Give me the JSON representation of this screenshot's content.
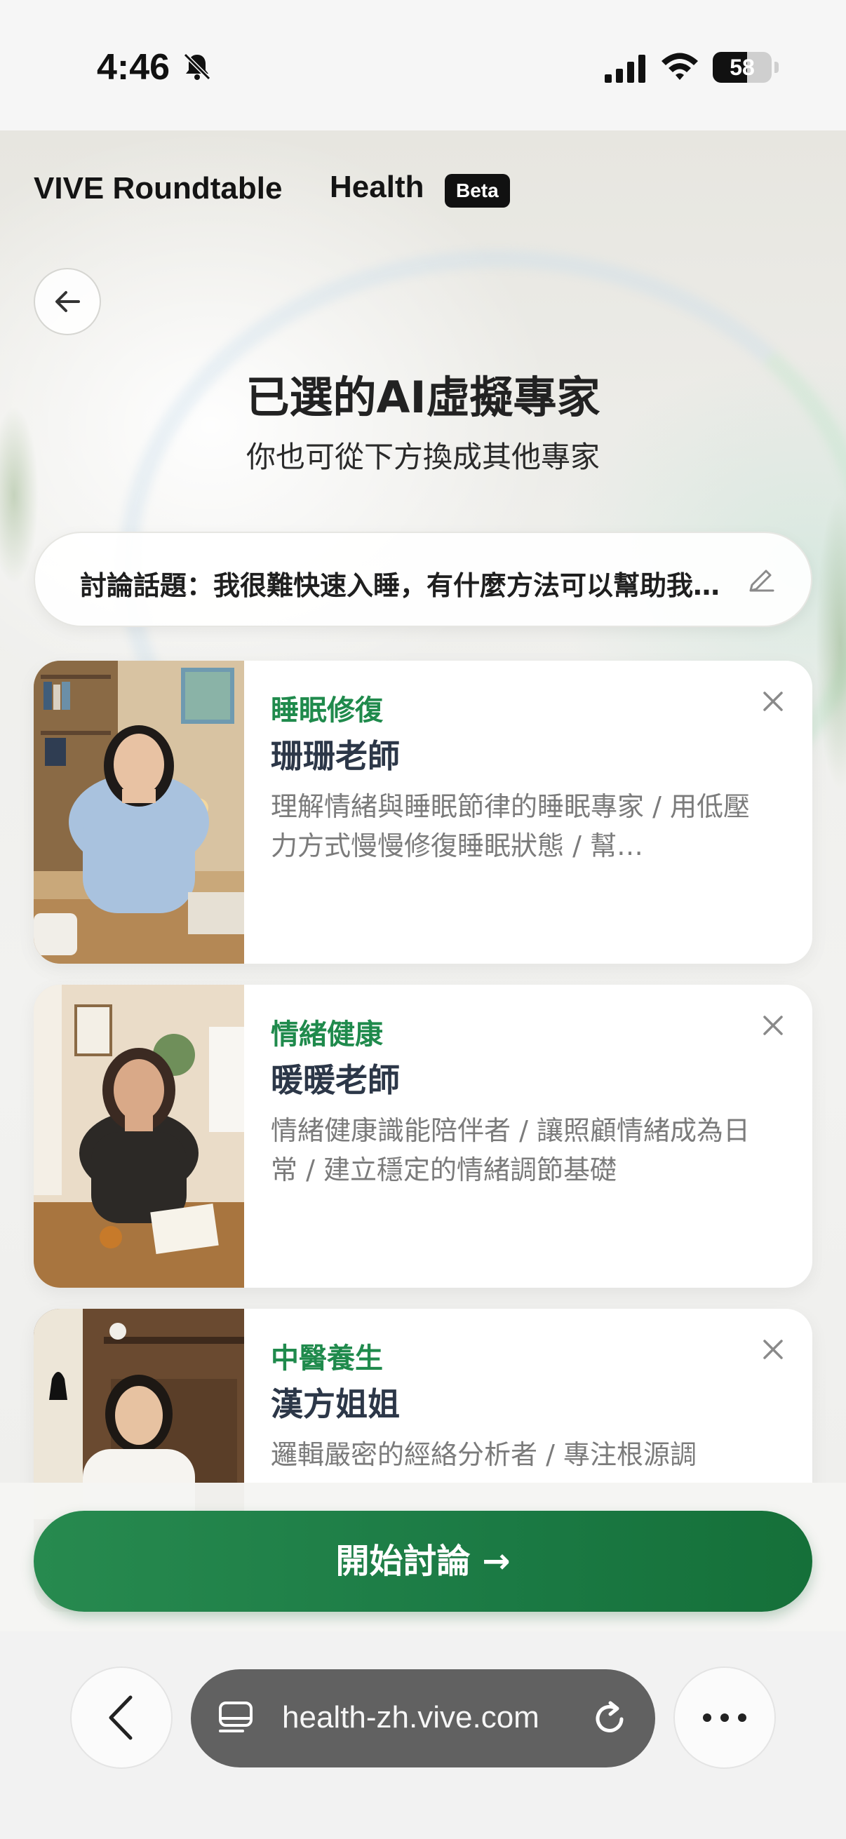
{
  "status_bar": {
    "time": "4:46",
    "battery": "58",
    "battery_level_pct": 58
  },
  "header": {
    "brand": "VIVE Roundtable",
    "product": "Health",
    "badge": "Beta"
  },
  "page": {
    "title": "已選的AI虛擬專家",
    "subtitle": "你也可從下方換成其他專家",
    "topic": "討論話題：我很難快速入睡，有什麼方法可以幫助我更快入睡？"
  },
  "experts": [
    {
      "category": "睡眠修復",
      "name": "珊珊老師",
      "description": "理解情緒與睡眠節律的睡眠專家 / 用低壓力方式慢慢修復睡眠狀態 / 幫…"
    },
    {
      "category": "情緒健康",
      "name": "暖暖老師",
      "description": "情緒健康識能陪伴者 / 讓照顧情緒成為日常 / 建立穩定的情緒調節基礎"
    },
    {
      "category": "中醫養生",
      "name": "漢方姐姐",
      "description": "邏輯嚴密的經絡分析者 / 專注根源調"
    }
  ],
  "cta": {
    "label": "開始討論 →"
  },
  "browser": {
    "url": "health-zh.vive.com"
  },
  "icons": {
    "back": "arrow-left-icon",
    "edit": "pencil-icon",
    "remove": "close-icon",
    "browser_back": "chevron-left-icon",
    "tabs": "tabs-icon",
    "reload": "reload-icon",
    "more": "ellipsis-icon"
  },
  "colors": {
    "accent_green": "#1f8a4c",
    "cta_green": "#1b7a44",
    "name_navy": "#2c3748"
  }
}
